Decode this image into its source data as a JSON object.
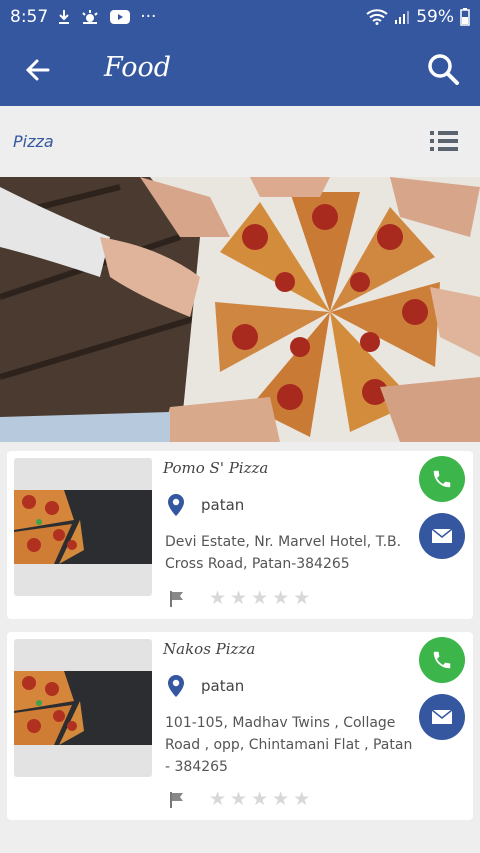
{
  "status": {
    "time": "8:57",
    "battery": "59%",
    "more": "···"
  },
  "appbar": {
    "title": "Food"
  },
  "subbar": {
    "category": "Pizza"
  },
  "listings": [
    {
      "name": "Pomo S' Pizza",
      "city": "patan",
      "address": "Devi Estate, Nr. Marvel Hotel, T.B.\nCross Road, Patan-384265",
      "rating": 0
    },
    {
      "name": "Nakos Pizza",
      "city": "patan",
      "address": "101-105, Madhav Twins , Collage\nRoad , opp, Chintamani Flat , Patan\n- 384265",
      "rating": 0
    }
  ],
  "colors": {
    "primary": "#35579f",
    "call": "#3cb54a",
    "background": "#eeeeee"
  },
  "icons": [
    "back-arrow-icon",
    "search-icon",
    "list-icon",
    "map-pin-icon",
    "flag-icon",
    "star-icon",
    "phone-icon",
    "mail-icon"
  ]
}
